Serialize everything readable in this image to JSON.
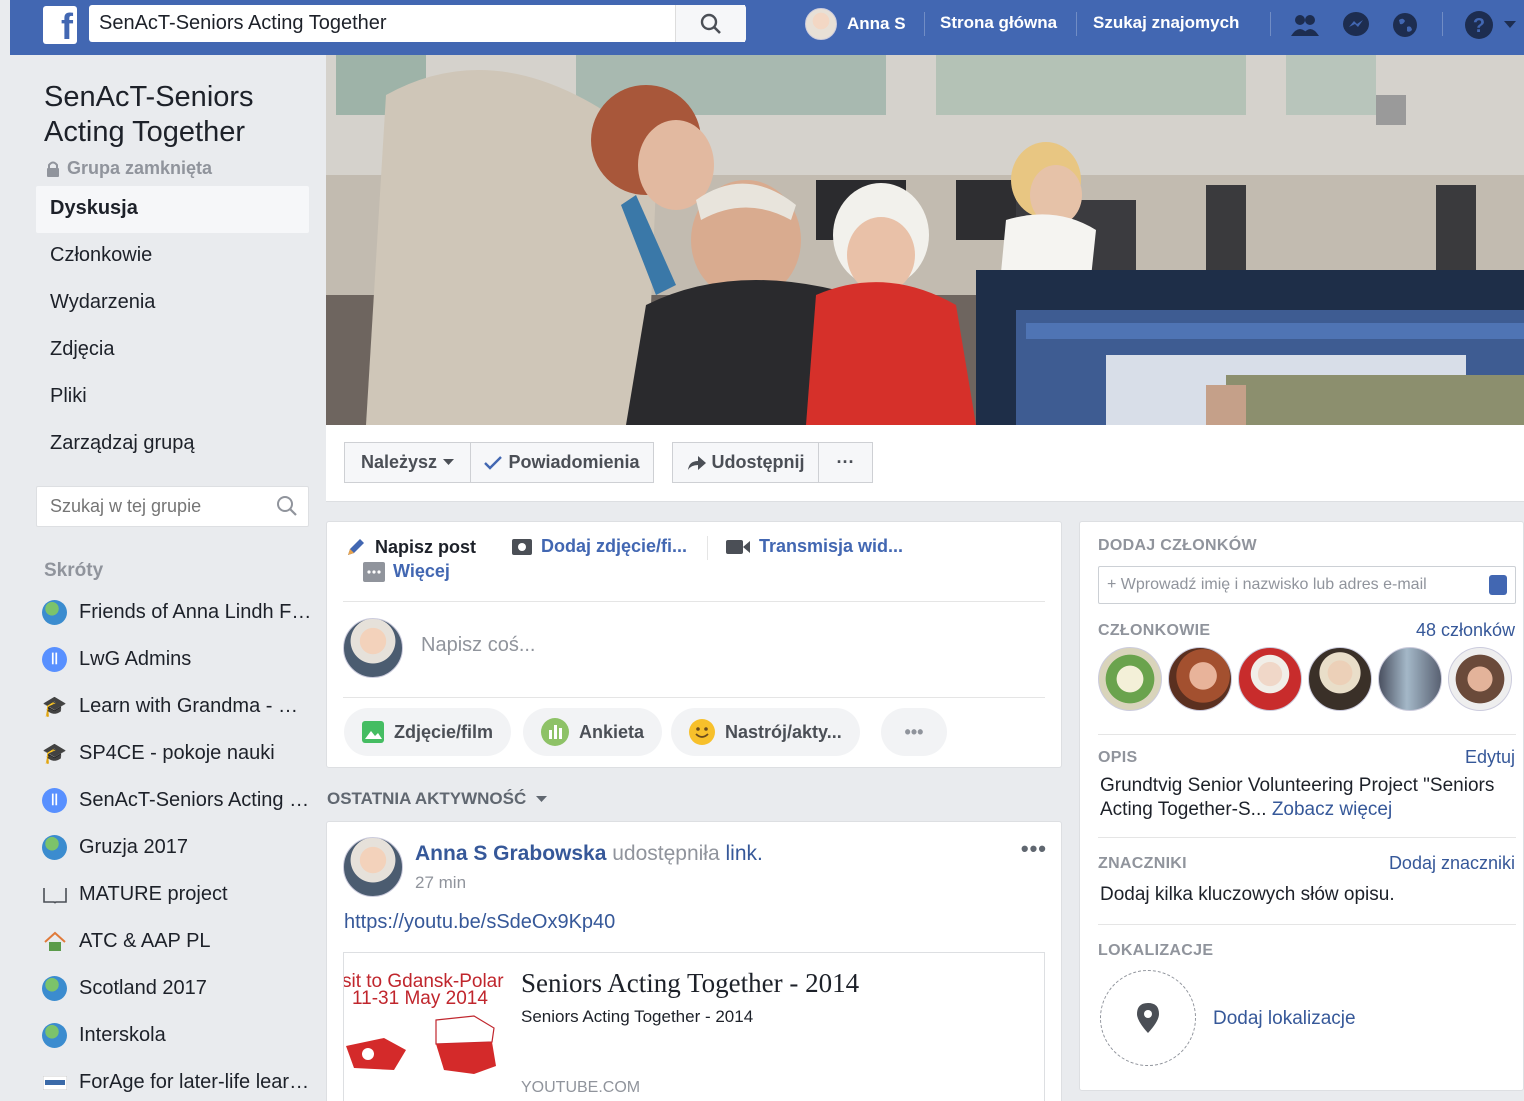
{
  "topbar": {
    "logo": "f",
    "search_value": "SenAcT-Seniors Acting Together",
    "user_name": "Anna S",
    "home_label": "Strona główna",
    "find_friends_label": "Szukaj znajomych",
    "icons": [
      "friends-icon",
      "messenger-icon",
      "notifications-globe-icon",
      "help-icon"
    ],
    "accent": "#4267b2"
  },
  "group": {
    "title": "SenAcT-Seniors Acting Together",
    "privacy": "Grupa zamknięta"
  },
  "nav": [
    {
      "label": "Dyskusja",
      "active": true
    },
    {
      "label": "Członkowie"
    },
    {
      "label": "Wydarzenia"
    },
    {
      "label": "Zdjęcia"
    },
    {
      "label": "Pliki"
    },
    {
      "label": "Zarządzaj grupą"
    }
  ],
  "group_search": {
    "placeholder": "Szukaj w tej grupie"
  },
  "shortcuts": {
    "title": "Skróty",
    "items": [
      {
        "label": "Friends of Anna Lindh F…",
        "icon": "globe-icon"
      },
      {
        "label": "LwG Admins",
        "icon": "group-icon"
      },
      {
        "label": "Learn with Grandma - …",
        "icon": "graduation-cap-icon"
      },
      {
        "label": "SP4CE - pokoje nauki",
        "icon": "graduation-cap-icon"
      },
      {
        "label": "SenAcT-Seniors Acting …",
        "icon": "group-icon"
      },
      {
        "label": "Gruzja 2017",
        "icon": "globe-icon"
      },
      {
        "label": "MATURE project",
        "icon": "book-icon"
      },
      {
        "label": "ATC & AAP PL",
        "icon": "house-icon"
      },
      {
        "label": "Scotland 2017",
        "icon": "globe-icon"
      },
      {
        "label": "Interskola",
        "icon": "globe-icon"
      },
      {
        "label": "ForAge for later-life lear…",
        "icon": "forage-logo-icon"
      }
    ]
  },
  "actions": {
    "member": "Należysz",
    "notifications": "Powiadomienia",
    "share": "Udostępnij",
    "more": "···"
  },
  "composer": {
    "write_post": "Napisz post",
    "add_photo": "Dodaj zdjęcie/fi...",
    "live_video": "Transmisja wid...",
    "more": "Więcej",
    "placeholder": "Napisz coś...",
    "pills": [
      "Zdjęcie/film",
      "Ankieta",
      "Nastrój/akty..."
    ],
    "pill_more": "•••"
  },
  "recent_activity": "OSTATNIA AKTYWNOŚĆ",
  "post": {
    "author": "Anna S Grabowska",
    "action": "udostępniła",
    "object": "link.",
    "time": "27 min",
    "url": "https://youtu.be/sSdeOx9Kp40",
    "more": "•••",
    "card": {
      "thumb_line1": "sit to Gdansk-Polar",
      "thumb_line2": "11-31 May 2014",
      "title": "Seniors Acting Together - 2014",
      "subtitle": "Seniors Acting Together - 2014",
      "domain": "YOUTUBE.COM"
    }
  },
  "sidebar_right": {
    "add_members_title": "DODAJ CZŁONKÓW",
    "add_members_placeholder": "+ Wprowadź imię i nazwisko lub adres e-mail",
    "members_title": "CZŁONKOWIE",
    "members_count": "48 członków",
    "description_title": "OPIS",
    "edit_label": "Edytuj",
    "description_text": "Grundtvig Senior Volunteering Project \"Seniors Acting Together-S...",
    "see_more": "Zobacz więcej",
    "tags_title": "ZNACZNIKI",
    "add_tags": "Dodaj znaczniki",
    "tags_hint": "Dodaj kilka kluczowych słów opisu.",
    "locations_title": "LOKALIZACJE",
    "add_location": "Dodaj lokalizacje"
  }
}
